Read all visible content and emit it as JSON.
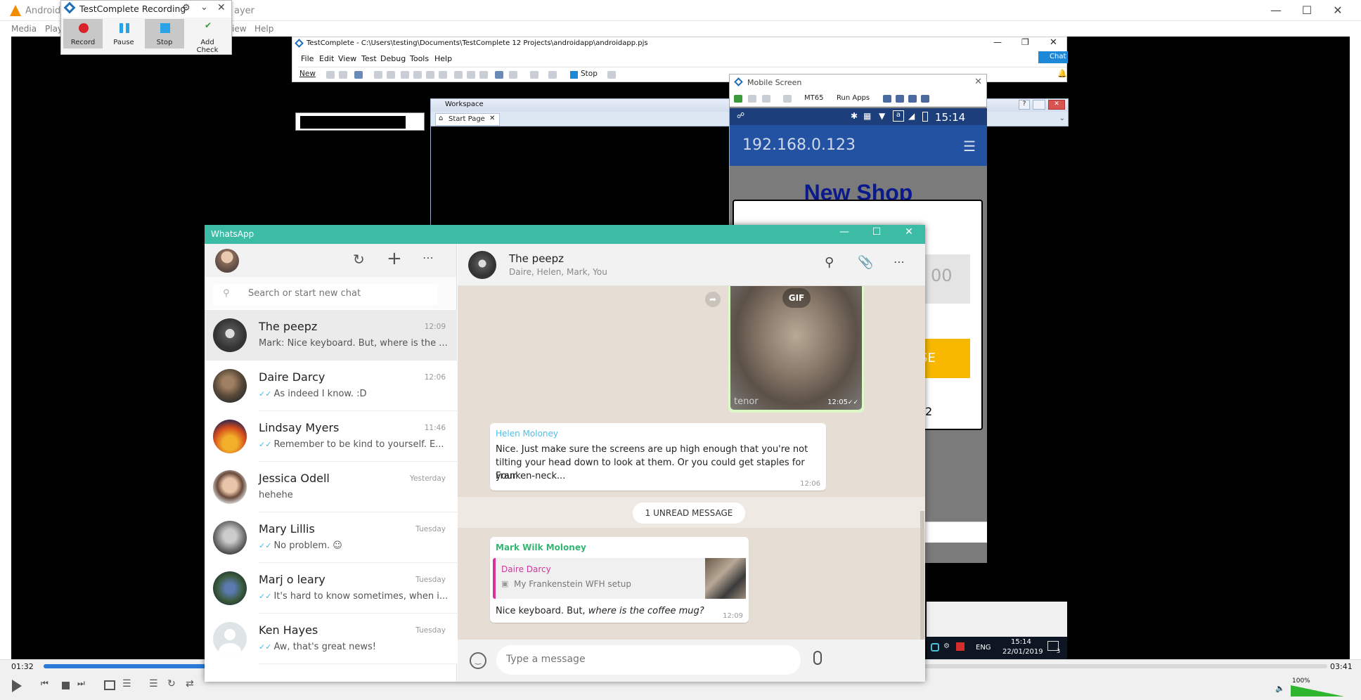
{
  "vlc": {
    "title": "Android",
    "title_tail": "ayer",
    "menu": [
      "Media",
      "Play",
      "iew",
      "Help"
    ],
    "time_elapsed": "01:32",
    "time_total": "03:41",
    "volume": "100%",
    "progress_fraction": 0.416
  },
  "tc_recording": {
    "title": "TestComplete Recording",
    "buttons": [
      "Record",
      "Pause",
      "Stop"
    ],
    "add_check": [
      "Add",
      "Check"
    ]
  },
  "testcomplete": {
    "title": "TestComplete - C:\\Users\\testing\\Documents\\TestComplete 12 Projects\\androidapp\\androidapp.pjs",
    "menu": [
      "File",
      "Edit",
      "View",
      "Test",
      "Debug",
      "Tools",
      "Help"
    ],
    "new_label": "New",
    "stop_label": "Stop",
    "chat_label": "Chat",
    "workspace_title": "Workspace",
    "start_page_tab": "Start Page"
  },
  "mobile": {
    "title": "Mobile Screen",
    "device": "MT65",
    "run_apps": "Run Apps",
    "clock": "15:14",
    "address": "192.168.0.123",
    "heading": "New Shop",
    "input_text": "00",
    "button_text": "SE",
    "count_text": "2"
  },
  "taskbar": {
    "lang": "ENG",
    "time": "15:14",
    "date": "22/01/2019",
    "notif_count": "3"
  },
  "whatsapp": {
    "title": "WhatsApp",
    "search_placeholder": "Search or start new chat",
    "chats": [
      {
        "name": "The peepz",
        "time": "12:09",
        "preview": "Mark: Nice keyboard. But, where is the ...",
        "ticks": false
      },
      {
        "name": "Daire Darcy",
        "time": "12:06",
        "preview": "As indeed I know. :D",
        "ticks": true
      },
      {
        "name": "Lindsay Myers",
        "time": "11:46",
        "preview": "Remember to be kind to yourself. E...",
        "ticks": true
      },
      {
        "name": "Jessica Odell",
        "time": "Yesterday",
        "preview": "hehehe",
        "ticks": false
      },
      {
        "name": "Mary Lillis",
        "time": "Tuesday",
        "preview": "No problem. ☺",
        "ticks": true
      },
      {
        "name": "Marj o leary",
        "time": "Tuesday",
        "preview": "It's hard to know sometimes, when i...",
        "ticks": true
      },
      {
        "name": "Ken Hayes",
        "time": "Tuesday",
        "preview": "Aw, that's great news!",
        "ticks": true
      }
    ],
    "conversation": {
      "name": "The peepz",
      "members": "Daire, Helen, Mark, You",
      "gif_label": "GIF",
      "gif_source": "tenor",
      "gif_time": "12:05",
      "msg1": {
        "sender": "Helen Moloney",
        "sender_color": "#4ebfe8",
        "lines": [
          "Nice. Just make sure the screens are up high enough that you're not",
          "tilting your head down to look at them. Or you could get staples for your",
          "Franken-neck..."
        ],
        "time": "12:06"
      },
      "unread": "1 UNREAD MESSAGE",
      "msg2": {
        "sender": "Mark Wilk Moloney",
        "sender_color": "#35b573",
        "quote_name": "Daire Darcy",
        "quote_color": "#d6339f",
        "quote_text": "My Frankenstein WFH setup",
        "text_plain": "Nice keyboard. But, ",
        "text_italic": "where is the coffee mug?",
        "time": "12:09"
      },
      "input_placeholder": "Type a message"
    }
  }
}
